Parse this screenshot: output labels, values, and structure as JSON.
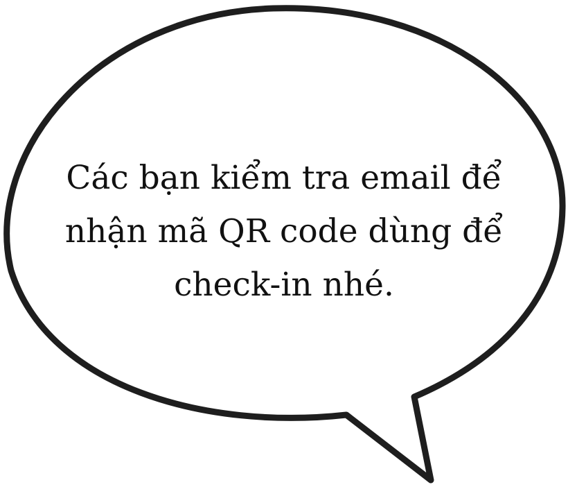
{
  "speech_bubble": {
    "stroke_color": "#1e1e1e",
    "fill_color": "#ffffff",
    "lines": [
      "Các bạn kiểm tra email để",
      "nhận mã QR code dùng để",
      "check-in nhé."
    ]
  }
}
